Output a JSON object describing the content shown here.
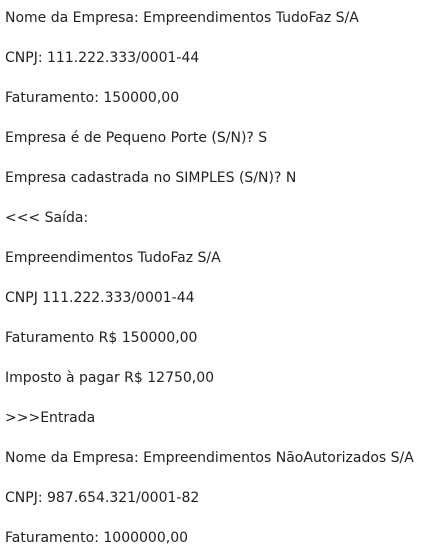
{
  "lines": [
    "Nome da Empresa: Empreendimentos TudoFaz S/A",
    "CNPJ: 111.222.333/0001-44",
    "Faturamento: 150000,00",
    "Empresa é de Pequeno Porte (S/N)? S",
    "Empresa cadastrada no SIMPLES (S/N)? N",
    "<<< Saída:",
    "Empreendimentos TudoFaz S/A",
    "CNPJ 111.222.333/0001-44",
    "Faturamento R$ 150000,00",
    "Imposto à pagar R$ 12750,00",
    ">>>Entrada",
    "Nome da Empresa: Empreendimentos NãoAutorizados S/A",
    "CNPJ: 987.654.321/0001-82",
    "Faturamento: 1000000,00"
  ]
}
